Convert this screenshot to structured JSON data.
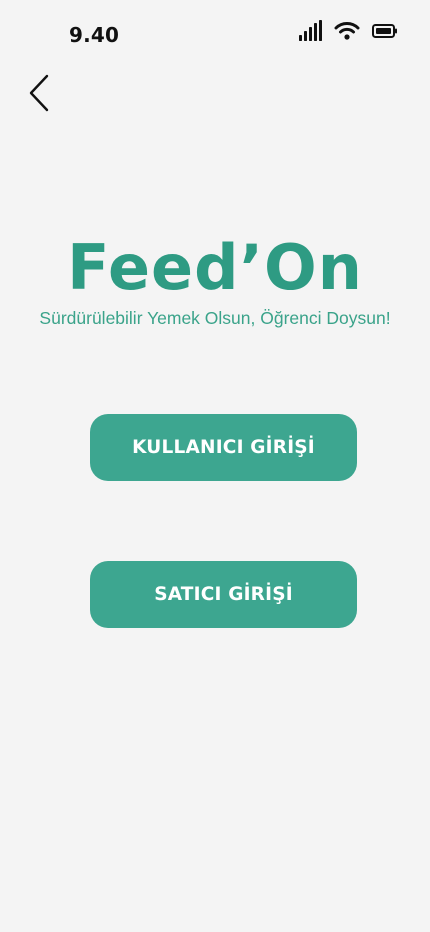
{
  "status_bar": {
    "time": "9.40",
    "icons": [
      "cellular-signal-icon",
      "wifi-icon",
      "battery-icon"
    ]
  },
  "header": {
    "back_icon": "chevron-left-icon"
  },
  "brand": {
    "name": "Feed’On",
    "tagline": "Sürdürülebilir Yemek Olsun, Öğrenci Doysun!",
    "color": "#2e9b83"
  },
  "actions": {
    "user_login_label": "KULLANICI GİRİŞİ",
    "seller_login_label": "SATICI GİRİŞİ",
    "button_color": "#3da690"
  }
}
